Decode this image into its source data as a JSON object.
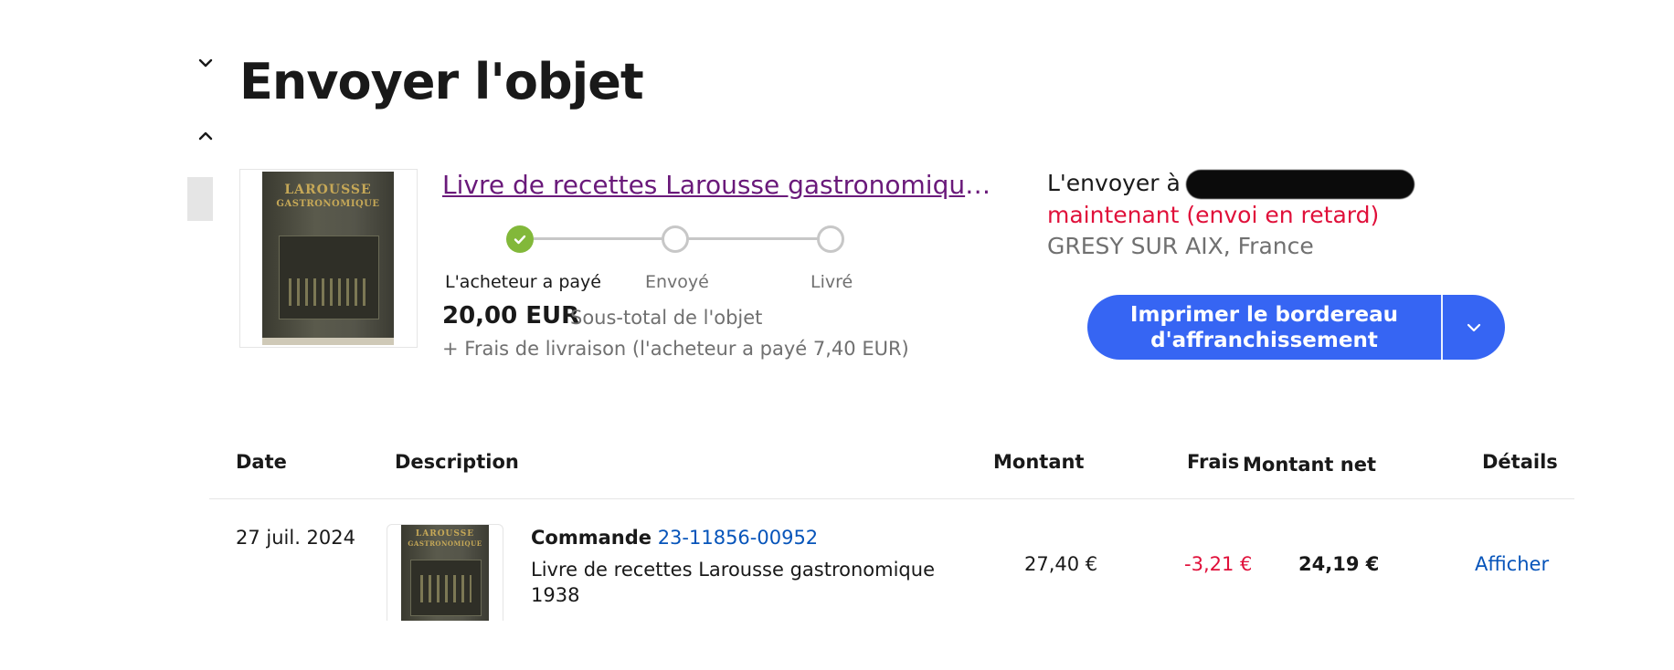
{
  "page": {
    "title": "Envoyer l'objet"
  },
  "item": {
    "title": "Livre de recettes Larousse gastronomique 1938",
    "thumbnail_text_top": "LAROUSSE",
    "thumbnail_text_bottom": "GASTRONOMIQUE",
    "tracker": {
      "steps": [
        {
          "label": "L'acheteur a payé",
          "status": "done"
        },
        {
          "label": "Envoyé",
          "status": "pending"
        },
        {
          "label": "Livré",
          "status": "pending"
        }
      ]
    },
    "price": "20,00 EUR",
    "price_label": "Sous-total de l'objet",
    "shipping_note": "+ Frais de livraison (l'acheteur a payé 7,40 EUR)"
  },
  "shipping": {
    "send_to_label": "L'envoyer à",
    "deadline": "maintenant (envoi en retard)",
    "location": "GRESY SUR AIX, France"
  },
  "print_button": {
    "label_line1": "Imprimer le bordereau",
    "label_line2": "d'affranchissement"
  },
  "table": {
    "headers": {
      "date": "Date",
      "description": "Description",
      "amount": "Montant",
      "fees": "Frais",
      "net": "Montant net",
      "details": "Détails"
    },
    "rows": [
      {
        "date": "27 juil. 2024",
        "order_label": "Commande",
        "order_number": "23-11856-00952",
        "desc_line1": "Livre de recettes Larousse gastronomique",
        "desc_line2": "1938",
        "amount": "27,40 €",
        "fees": "-3,21 €",
        "net": "24,19 €",
        "details": "Afficher"
      }
    ]
  },
  "colors": {
    "primary_button": "#3665f3",
    "link_visited": "#6a1a7a",
    "link": "#0654ba",
    "alert_red": "#e0103a",
    "success_green": "#82b83a"
  }
}
